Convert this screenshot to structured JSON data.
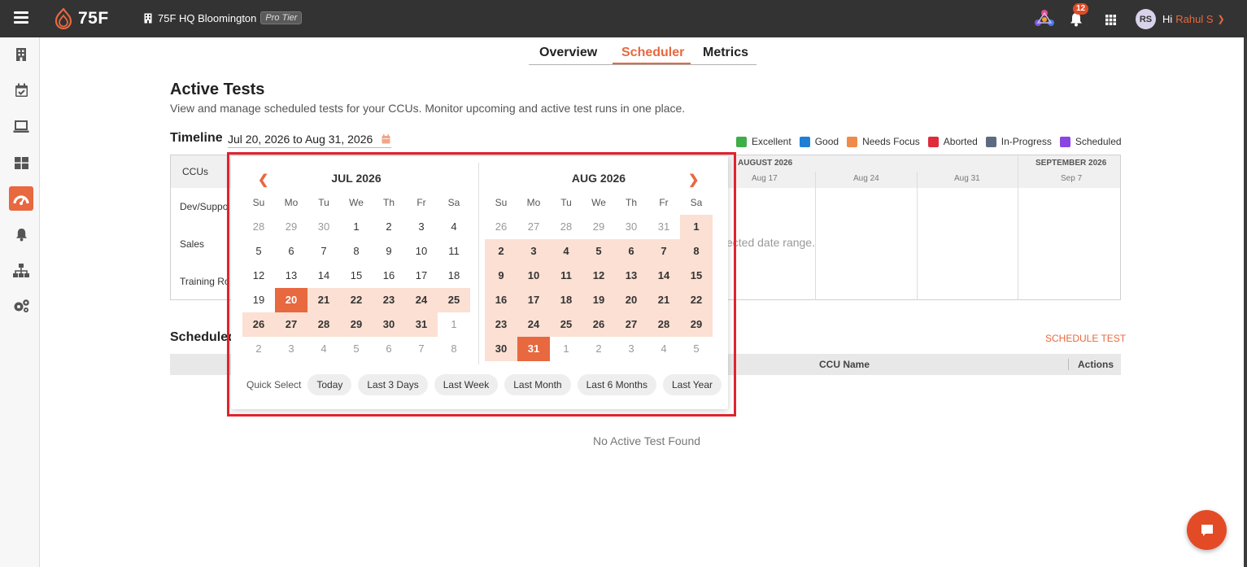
{
  "header": {
    "logo_text": "75F",
    "site_name": "75F HQ Bloomington",
    "tier": "Pro Tier",
    "notification_count": "12",
    "avatar_initials": "RS",
    "greeting": "Hi",
    "user_name": "Rahul S"
  },
  "tabs": [
    {
      "label": "Overview"
    },
    {
      "label": "Scheduler"
    },
    {
      "label": "Metrics"
    }
  ],
  "page": {
    "title": "Active Tests",
    "subtitle": "View and manage scheduled tests for your CCUs. Monitor upcoming and active test runs in one place."
  },
  "timeline": {
    "label": "Timeline",
    "date_range": "Jul 20, 2026 to Aug 31, 2026",
    "ccus_header": "CCUs",
    "months": [
      "AUGUST 2026",
      "SEPTEMBER 2026"
    ],
    "weeks": [
      "Aug 17",
      "Aug 24",
      "Aug 31",
      "Sep 7"
    ],
    "rows": [
      "Dev/Suppo",
      "Sales",
      "Training Ro"
    ],
    "empty_text": "ected date range."
  },
  "legend": [
    {
      "label": "Excellent",
      "color": "#3fae49"
    },
    {
      "label": "Good",
      "color": "#1f7fd6"
    },
    {
      "label": "Needs Focus",
      "color": "#f08a4b"
    },
    {
      "label": "Aborted",
      "color": "#e02b3a"
    },
    {
      "label": "In-Progress",
      "color": "#5d6b82"
    },
    {
      "label": "Scheduled",
      "color": "#8a46e0"
    }
  ],
  "scheduled": {
    "title": "Scheduled",
    "action": "SCHEDULE TEST",
    "col_ccu": "CCU Name",
    "col_actions": "Actions",
    "empty_text": "No Active Test Found"
  },
  "picker": {
    "weekdays": [
      "Su",
      "Mo",
      "Tu",
      "We",
      "Th",
      "Fr",
      "Sa"
    ],
    "months": [
      {
        "title": "JUL 2026",
        "weeks": [
          [
            {
              "d": "28",
              "s": "muted"
            },
            {
              "d": "29",
              "s": "muted"
            },
            {
              "d": "30",
              "s": "muted"
            },
            {
              "d": "1",
              "s": ""
            },
            {
              "d": "2",
              "s": ""
            },
            {
              "d": "3",
              "s": ""
            },
            {
              "d": "4",
              "s": ""
            }
          ],
          [
            {
              "d": "5",
              "s": ""
            },
            {
              "d": "6",
              "s": ""
            },
            {
              "d": "7",
              "s": ""
            },
            {
              "d": "8",
              "s": ""
            },
            {
              "d": "9",
              "s": ""
            },
            {
              "d": "10",
              "s": ""
            },
            {
              "d": "11",
              "s": ""
            }
          ],
          [
            {
              "d": "12",
              "s": ""
            },
            {
              "d": "13",
              "s": ""
            },
            {
              "d": "14",
              "s": ""
            },
            {
              "d": "15",
              "s": ""
            },
            {
              "d": "16",
              "s": ""
            },
            {
              "d": "17",
              "s": ""
            },
            {
              "d": "18",
              "s": ""
            }
          ],
          [
            {
              "d": "19",
              "s": ""
            },
            {
              "d": "20",
              "s": "sel"
            },
            {
              "d": "21",
              "s": "inrange"
            },
            {
              "d": "22",
              "s": "inrange"
            },
            {
              "d": "23",
              "s": "inrange"
            },
            {
              "d": "24",
              "s": "inrange"
            },
            {
              "d": "25",
              "s": "inrange"
            }
          ],
          [
            {
              "d": "26",
              "s": "inrange"
            },
            {
              "d": "27",
              "s": "inrange"
            },
            {
              "d": "28",
              "s": "inrange"
            },
            {
              "d": "29",
              "s": "inrange"
            },
            {
              "d": "30",
              "s": "inrange"
            },
            {
              "d": "31",
              "s": "inrange"
            },
            {
              "d": "1",
              "s": "muted"
            }
          ],
          [
            {
              "d": "2",
              "s": "muted"
            },
            {
              "d": "3",
              "s": "muted"
            },
            {
              "d": "4",
              "s": "muted"
            },
            {
              "d": "5",
              "s": "muted"
            },
            {
              "d": "6",
              "s": "muted"
            },
            {
              "d": "7",
              "s": "muted"
            },
            {
              "d": "8",
              "s": "muted"
            }
          ]
        ]
      },
      {
        "title": "AUG 2026",
        "weeks": [
          [
            {
              "d": "26",
              "s": "muted"
            },
            {
              "d": "27",
              "s": "muted"
            },
            {
              "d": "28",
              "s": "muted"
            },
            {
              "d": "29",
              "s": "muted"
            },
            {
              "d": "30",
              "s": "muted"
            },
            {
              "d": "31",
              "s": "muted"
            },
            {
              "d": "1",
              "s": "inrange"
            }
          ],
          [
            {
              "d": "2",
              "s": "inrange"
            },
            {
              "d": "3",
              "s": "inrange"
            },
            {
              "d": "4",
              "s": "inrange"
            },
            {
              "d": "5",
              "s": "inrange"
            },
            {
              "d": "6",
              "s": "inrange"
            },
            {
              "d": "7",
              "s": "inrange"
            },
            {
              "d": "8",
              "s": "inrange"
            }
          ],
          [
            {
              "d": "9",
              "s": "inrange"
            },
            {
              "d": "10",
              "s": "inrange"
            },
            {
              "d": "11",
              "s": "inrange"
            },
            {
              "d": "12",
              "s": "inrange"
            },
            {
              "d": "13",
              "s": "inrange"
            },
            {
              "d": "14",
              "s": "inrange"
            },
            {
              "d": "15",
              "s": "inrange"
            }
          ],
          [
            {
              "d": "16",
              "s": "inrange"
            },
            {
              "d": "17",
              "s": "inrange"
            },
            {
              "d": "18",
              "s": "inrange"
            },
            {
              "d": "19",
              "s": "inrange"
            },
            {
              "d": "20",
              "s": "inrange"
            },
            {
              "d": "21",
              "s": "inrange"
            },
            {
              "d": "22",
              "s": "inrange"
            }
          ],
          [
            {
              "d": "23",
              "s": "inrange"
            },
            {
              "d": "24",
              "s": "inrange"
            },
            {
              "d": "25",
              "s": "inrange"
            },
            {
              "d": "26",
              "s": "inrange"
            },
            {
              "d": "27",
              "s": "inrange"
            },
            {
              "d": "28",
              "s": "inrange"
            },
            {
              "d": "29",
              "s": "inrange"
            }
          ],
          [
            {
              "d": "30",
              "s": "inrange"
            },
            {
              "d": "31",
              "s": "sel"
            },
            {
              "d": "1",
              "s": "muted"
            },
            {
              "d": "2",
              "s": "muted"
            },
            {
              "d": "3",
              "s": "muted"
            },
            {
              "d": "4",
              "s": "muted"
            },
            {
              "d": "5",
              "s": "muted"
            }
          ]
        ]
      }
    ],
    "quick_label": "Quick Select",
    "quick_options": [
      "Today",
      "Last 3 Days",
      "Last Week",
      "Last Month",
      "Last 6 Months",
      "Last Year"
    ]
  },
  "colors": {
    "accent": "#e8683f",
    "highlight_outline": "#e0232f",
    "range_fill": "#fbe0d3"
  }
}
